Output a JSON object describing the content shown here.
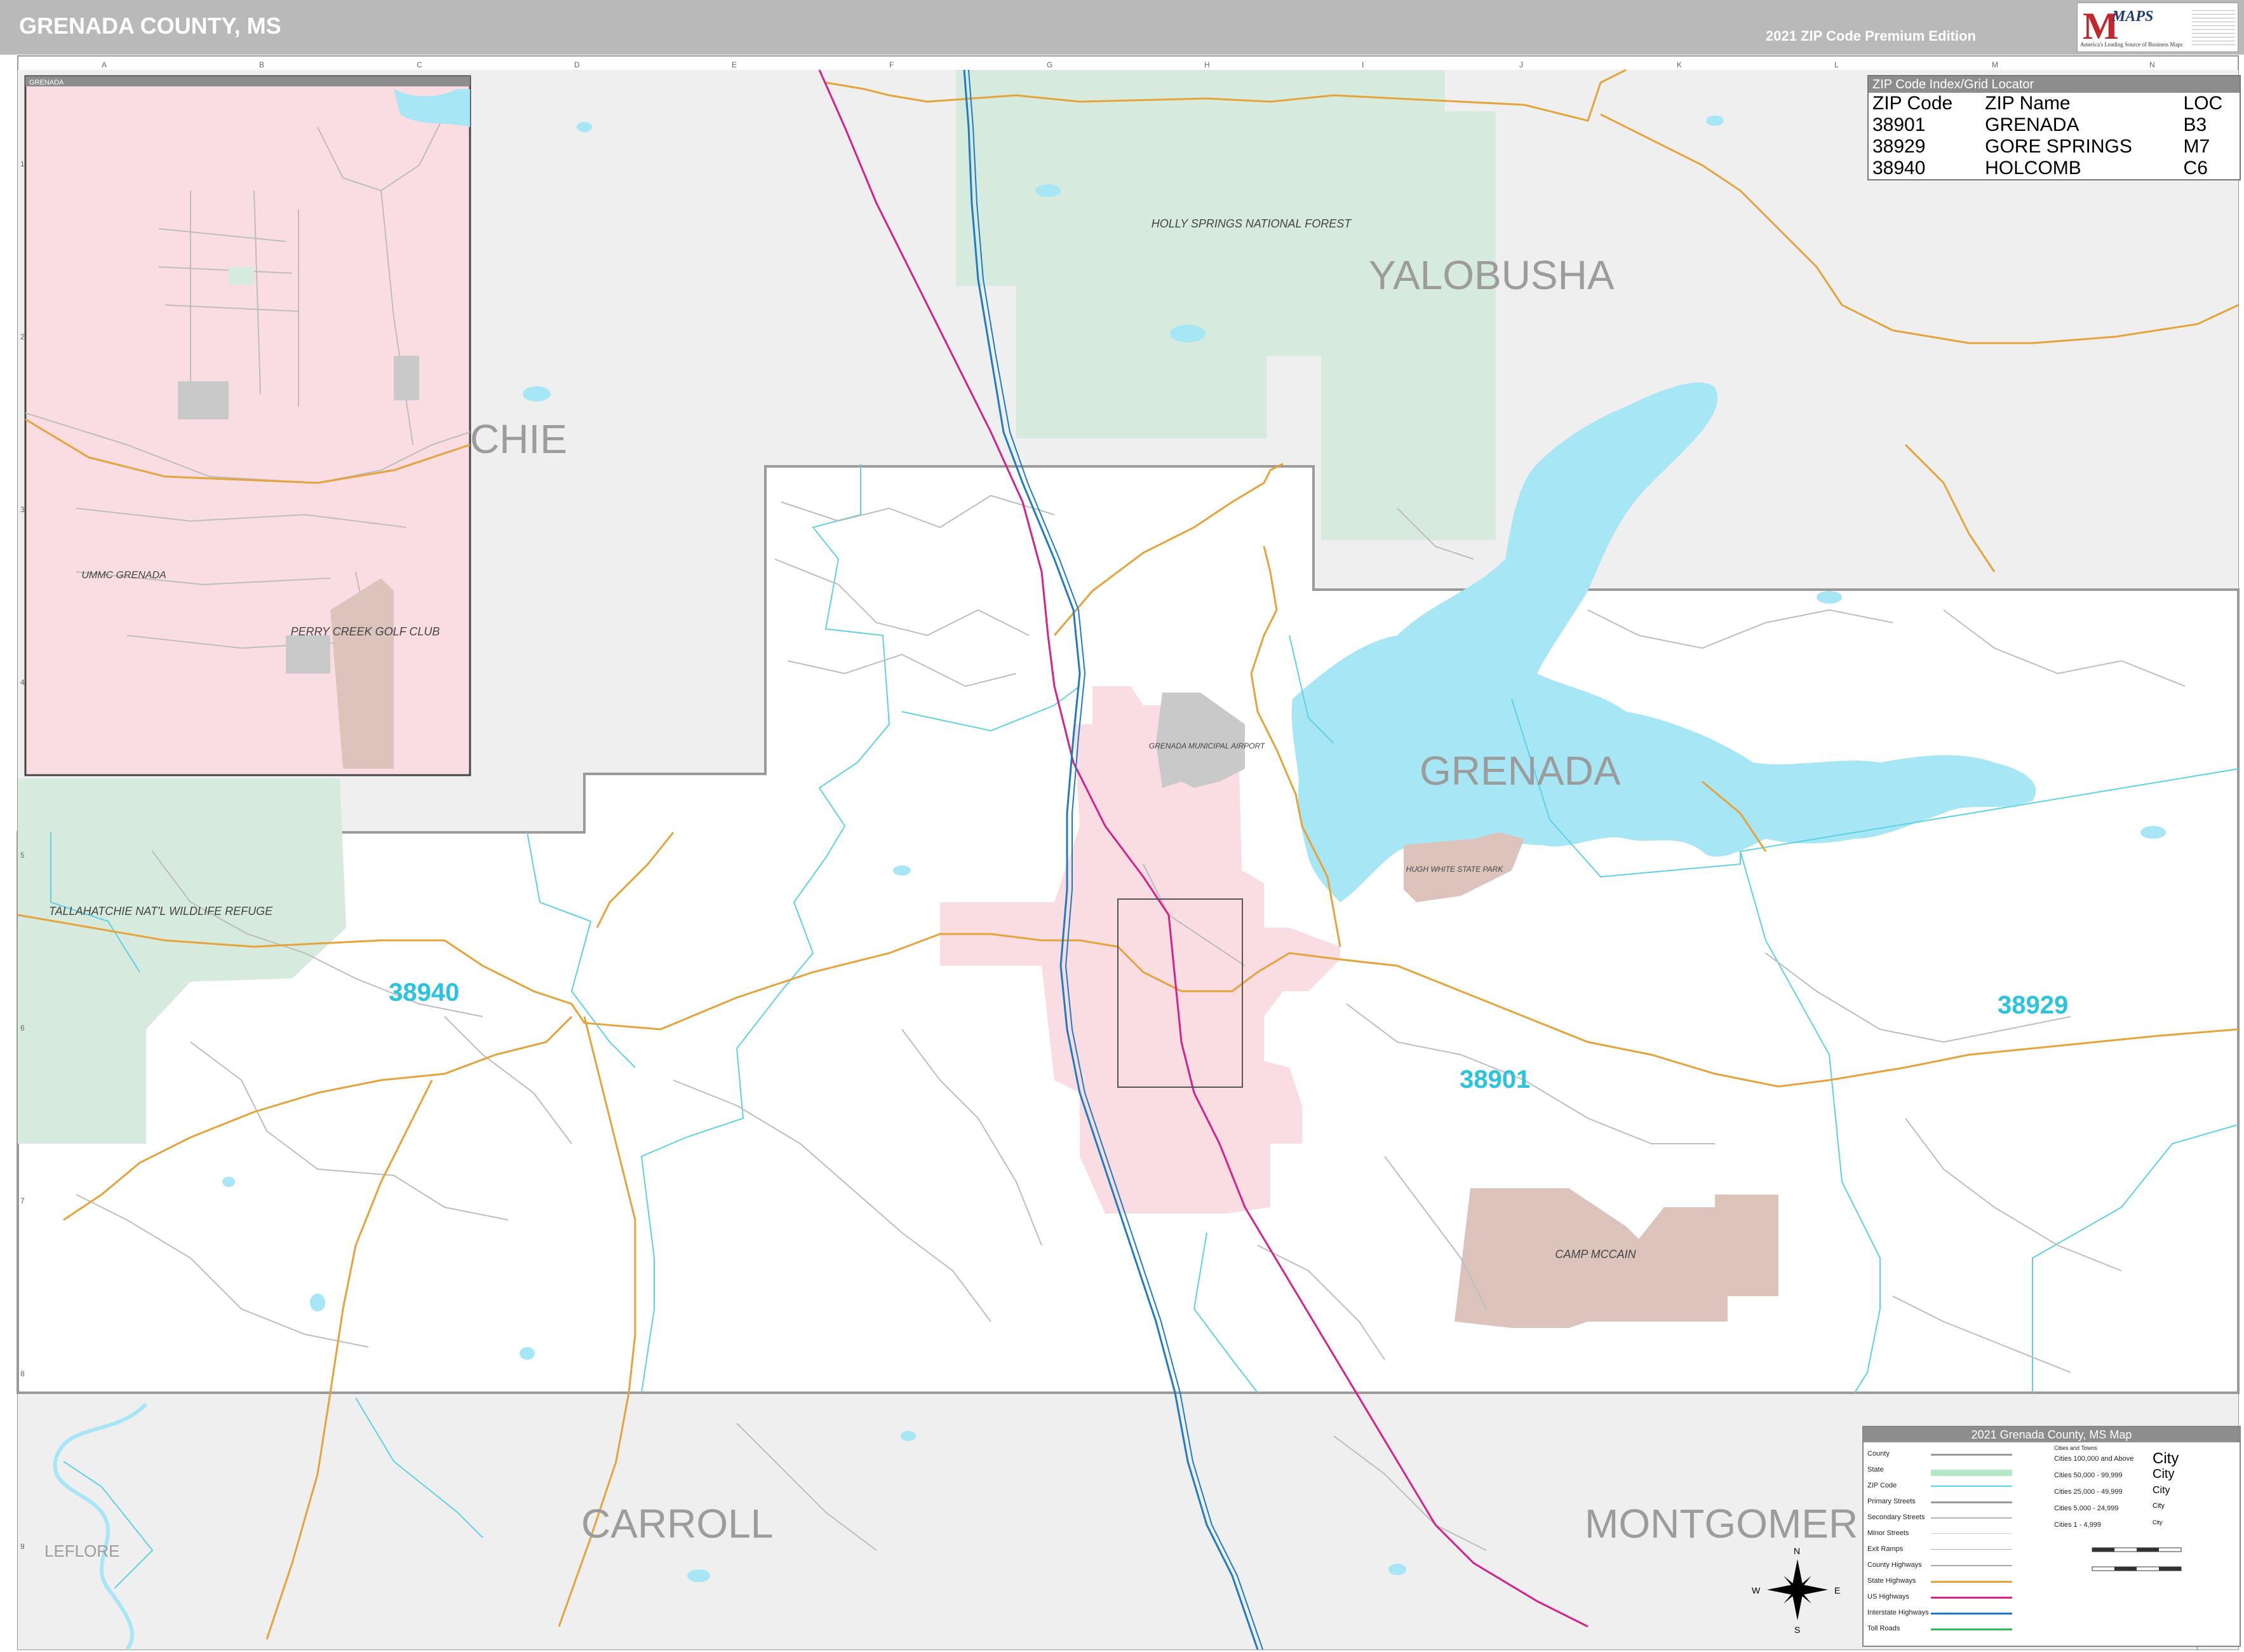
{
  "header": {
    "title": "GRENADA COUNTY, MS",
    "edition": "2021 ZIP Code Premium Edition"
  },
  "logo": {
    "mark": "M",
    "wordmark": "MAPS",
    "tagline": "America's Leading Source of Business Maps"
  },
  "colors": {
    "water": "#a6e6f5",
    "forest": "#d6eadd",
    "city": "#f9dde2",
    "neighbor_county": "#efefef",
    "interstate": "#1f7bc4",
    "us_highway": "#d6218a",
    "state_highway": "#e5a43b",
    "zip_boundary": "#5fd1e6",
    "zip_label": "#2bc3de",
    "military": "#dcc4bd",
    "county_boundary": "#9a9a9a"
  },
  "grid": {
    "columns": [
      "A",
      "B",
      "C",
      "D",
      "E",
      "F",
      "G",
      "H",
      "I",
      "J",
      "K",
      "L",
      "M",
      "N"
    ],
    "rows": [
      "1",
      "2",
      "3",
      "4",
      "5",
      "6",
      "7",
      "8",
      "9"
    ]
  },
  "counties": {
    "yalobusha": "YALOBUSHA",
    "tallahatchie_partial": "CHIE",
    "grenada": "GRENADA",
    "carroll": "CARROLL",
    "montgomery_partial": "MONTGOMER",
    "leflore": "LEFLORE"
  },
  "zips": [
    {
      "code": "38940",
      "name": "HOLCOMB",
      "loc": "C6"
    },
    {
      "code": "38901",
      "name": "GRENADA",
      "loc": "B3"
    },
    {
      "code": "38929",
      "name": "GORE SPRINGS",
      "loc": "M7"
    }
  ],
  "features": {
    "holly_springs": "HOLLY SPRINGS NATIONAL FOREST",
    "tallahatchie_refuge": "TALLAHATCHIE NAT'L WILDLIFE REFUGE",
    "camp_mccain": "CAMP MCCAIN",
    "airport": "GRENADA MUNICIPAL AIRPORT",
    "hugh_white": "HUGH WHITE STATE PARK",
    "perry_creek": "PERRY CREEK GOLF CLUB",
    "ummc": "UMMC GRENADA"
  },
  "inset": {
    "label": "GRENADA"
  },
  "zip_index": {
    "caption": "ZIP Code Index/Grid Locator",
    "headers": [
      "ZIP Code",
      "ZIP Name",
      "LOC"
    ],
    "rows": [
      [
        "38901",
        "GRENADA",
        "B3"
      ],
      [
        "38929",
        "GORE SPRINGS",
        "M7"
      ],
      [
        "38940",
        "HOLCOMB",
        "C6"
      ]
    ]
  },
  "legend": {
    "caption": "2021 Grenada County, MS Map",
    "items": [
      "County",
      "State",
      "ZIP Code",
      "Primary Streets",
      "Secondary Streets",
      "Minor Streets",
      "Exit Ramps",
      "County Highways",
      "State Highways",
      "US Highways",
      "Interstate Highways",
      "Toll Roads"
    ],
    "cities_caption": "Cities and Towns",
    "cities": [
      "Cities 100,000 and Above",
      "Cities 50,000 - 99,999",
      "Cities 25,000 - 49,999",
      "Cities 5,000 - 24,999",
      "Cities 1 - 4,999"
    ],
    "city_samples": [
      "City",
      "City",
      "City",
      "City",
      "City"
    ]
  },
  "compass": {
    "n": "N",
    "s": "S",
    "e": "E",
    "w": "W"
  }
}
